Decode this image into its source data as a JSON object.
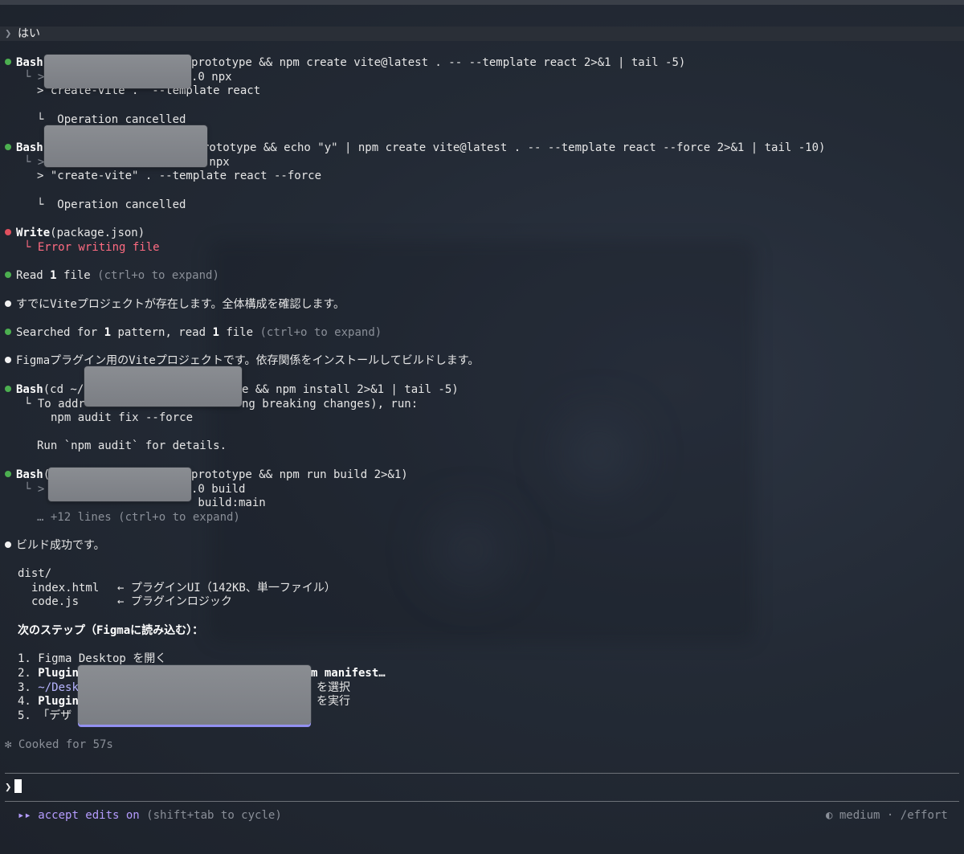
{
  "prompt_echo": {
    "symbol": "❯",
    "text": "はい"
  },
  "entries": {
    "bash1": {
      "tool": "Bash",
      "command_tail": "prototype && npm create vite@latest . -- --template react 2>&1 | tail -5)",
      "out1_prefix": "└ >",
      "out1_tail": ".0 npx",
      "out2": "> create-vite .  --template react",
      "out3": "└  Operation cancelled"
    },
    "bash2": {
      "tool": "Bash",
      "command_tail": "rototype && echo \"y\" | npm create vite@latest . -- --template react --force 2>&1 | tail -10)",
      "out1_prefix": "└ >",
      "out1_tail": " npx",
      "out2": "> \"create-vite\" . --template react --force",
      "out3": "└  Operation cancelled"
    },
    "write": {
      "tool": "Write",
      "arg": "(package.json)",
      "out": "└ Error writing file"
    },
    "read": {
      "prefix": "Read ",
      "count": "1",
      "suffix": " file ",
      "hint": "(ctrl+o to expand)"
    },
    "msg1": "すでにViteプロジェクトが存在します。全体構成を確認します。",
    "search": {
      "prefix": "Searched for ",
      "count1": "1",
      "mid": " pattern, read ",
      "count2": "1",
      "suffix": " file ",
      "hint": "(ctrl+o to expand)"
    },
    "msg2": "Figmaプラグイン用のViteプロジェクトです。依存関係をインストールしてビルドします。",
    "bash3": {
      "tool": "Bash",
      "command_head": "(cd ~/",
      "command_tail": "e && npm install 2>&1 | tail -5)",
      "out1_head": "└ To addr",
      "out1_tail": "ng breaking changes), run:",
      "out2": "npm audit fix --force",
      "out3": "Run `npm audit` for details."
    },
    "bash4": {
      "tool": "Bash",
      "command_head": "(",
      "command_tail": "prototype && npm run build 2>&1)",
      "out1_prefix": "└ >",
      "out1_tail": ".0 build",
      "out2_tail": " build:main",
      "out3_prefix": "… ",
      "out3": "+12 lines (ctrl+o to expand)"
    },
    "msg3": "ビルド成功です。",
    "tree": {
      "root": "dist/",
      "file1": "index.html",
      "file1_desc": "← プラグインUI（142KB、単一ファイル）",
      "file2": "code.js",
      "file2_desc": "← プラグインロジック"
    },
    "next_heading": "次のステップ（Figmaに読み込む）：",
    "steps": {
      "s1": "1. Figma Desktop を開く",
      "s2_num": "2. ",
      "s2_bold": "Plugin",
      "s2_tail": "m manifest…",
      "s3_num": "3. ",
      "s3_link": "~/Desk",
      "s3_tail": "を選択",
      "s4_num": "4. ",
      "s4_bold": "Plugin",
      "s4_tail": "を実行",
      "s5": "5. 「デザ"
    },
    "cooked": "✻ Cooked for 57s"
  },
  "input": {
    "symbol": "❯",
    "value": ""
  },
  "status": {
    "mode_icon": "▸▸",
    "mode_label": "accept edits on",
    "mode_hint": "(shift+tab to cycle)",
    "effort_icon": "◐",
    "effort_level": "medium",
    "separator": "·",
    "effort_command": "/effort"
  },
  "colors": {
    "accent": "#b59cff",
    "success_dot": "#4caf50",
    "error_dot": "#e0505e",
    "error_text": "#ff6b81"
  }
}
